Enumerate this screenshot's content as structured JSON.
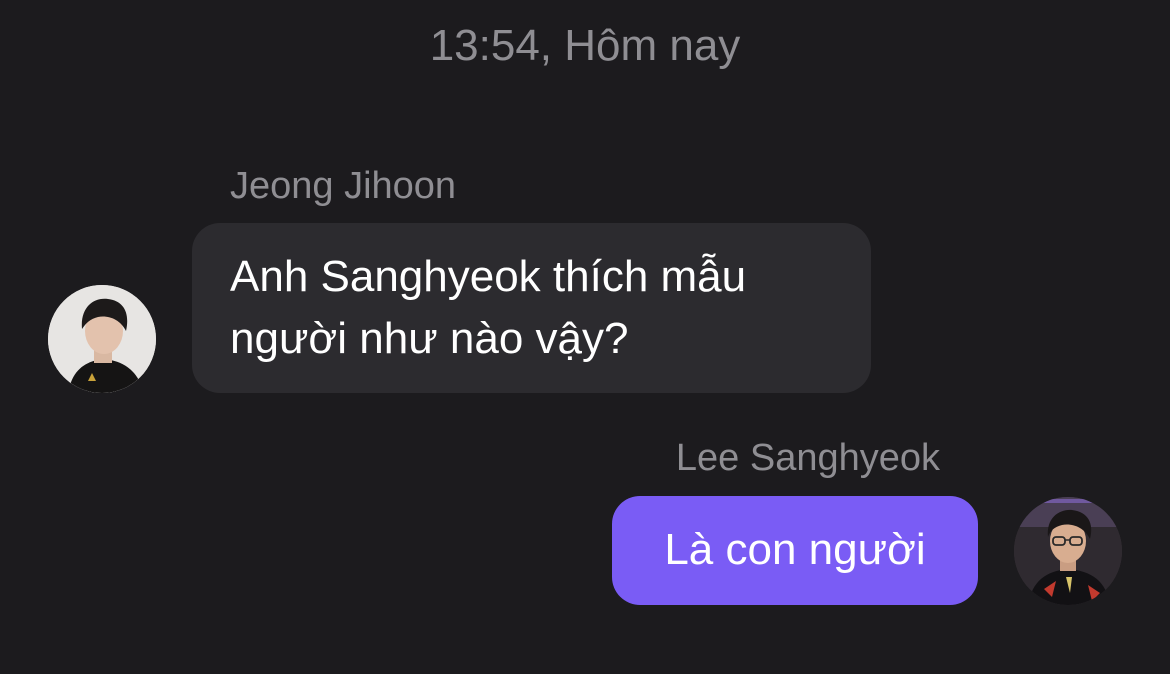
{
  "conversation": {
    "timestamp": "13:54, Hôm nay",
    "messages": [
      {
        "sender": "Jeong Jihoon",
        "direction": "incoming",
        "text_lines": [
          "Anh Sanghyeok thích mẫu",
          "người như nào vậy?"
        ],
        "bubble_color": "#2c2b2f"
      },
      {
        "sender": "Lee Sanghyeok",
        "direction": "outgoing",
        "text": "Là con người",
        "bubble_color": "#7a5cf5"
      }
    ]
  },
  "theme": {
    "background": "#1c1b1e",
    "secondary_text": "#8f8e93",
    "primary_text": "#ffffff"
  }
}
